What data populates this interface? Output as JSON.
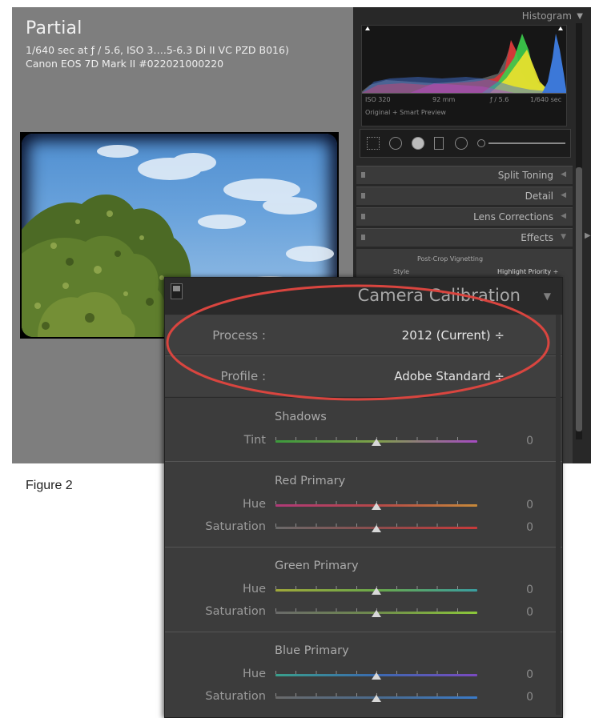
{
  "lightroom": {
    "info": {
      "title": "Partial",
      "line1": "1/640 sec at ƒ / 5.6, ISO 3….5-6.3 Di II VC PZD B016)",
      "line2": "Canon EOS 7D Mark II #022021000220"
    },
    "histogram": {
      "label": "Histogram",
      "iso": "ISO 320",
      "focal": "92 mm",
      "aperture": "ƒ / 5.6",
      "shutter": "1/640 sec",
      "preview": "Original + Smart Preview"
    },
    "panels": [
      {
        "name": "Split Toning"
      },
      {
        "name": "Detail"
      },
      {
        "name": "Lens Corrections"
      },
      {
        "name": "Effects"
      }
    ],
    "effects": {
      "section": "Post-Crop Vignetting",
      "style_label": "Style",
      "style_value": "Highlight Priority ÷"
    }
  },
  "figure_caption": "Figure 2",
  "calibration": {
    "title": "Camera Calibration",
    "process_label": "Process :",
    "process_value": "2012 (Current) ÷",
    "profile_label": "Profile :",
    "profile_value": "Adobe Standard ÷",
    "sections": [
      {
        "title": "Shadows",
        "sliders": [
          {
            "label": "Tint",
            "value": "0",
            "position": 0.5
          }
        ]
      },
      {
        "title": "Red Primary",
        "sliders": [
          {
            "label": "Hue",
            "value": "0",
            "position": 0.5
          },
          {
            "label": "Saturation",
            "value": "0",
            "position": 0.5
          }
        ]
      },
      {
        "title": "Green Primary",
        "sliders": [
          {
            "label": "Hue",
            "value": "0",
            "position": 0.5
          },
          {
            "label": "Saturation",
            "value": "0",
            "position": 0.5
          }
        ]
      },
      {
        "title": "Blue Primary",
        "sliders": [
          {
            "label": "Hue",
            "value": "0",
            "position": 0.5
          },
          {
            "label": "Saturation",
            "value": "0",
            "position": 0.5
          }
        ]
      }
    ]
  },
  "colors": {
    "highlight_ellipse": "#d9453f",
    "panel_bg": "#3c3c3c"
  },
  "icons": [
    "panel-switch-icon",
    "collapse-triangle-icon",
    "slider-thumb-icon",
    "stepper-arrows-icon"
  ]
}
